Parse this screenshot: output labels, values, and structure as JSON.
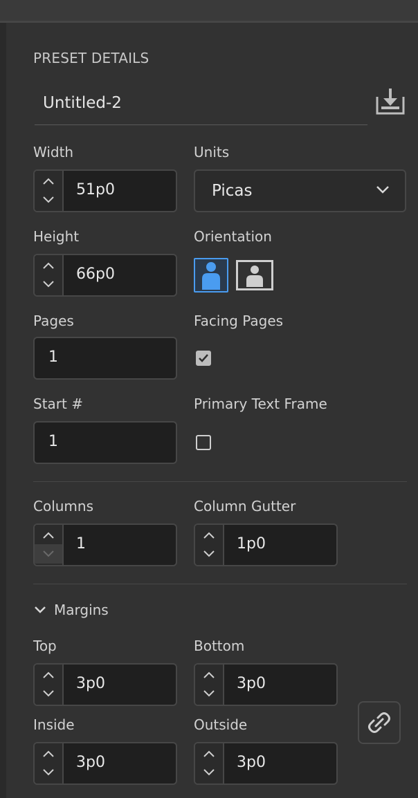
{
  "panel": {
    "section_title": "PRESET DETAILS",
    "document_name": "Untitled-2",
    "save_preset_icon": "save-preset-icon"
  },
  "fields": {
    "width": {
      "label": "Width",
      "value": "51p0"
    },
    "height": {
      "label": "Height",
      "value": "66p0"
    },
    "units": {
      "label": "Units",
      "value": "Picas"
    },
    "orientation": {
      "label": "Orientation",
      "selected": "portrait"
    },
    "pages": {
      "label": "Pages",
      "value": "1"
    },
    "facing_pages": {
      "label": "Facing Pages",
      "checked": true
    },
    "start_number": {
      "label": "Start #",
      "value": "1"
    },
    "primary_text_frame": {
      "label": "Primary Text Frame",
      "checked": false
    },
    "columns": {
      "label": "Columns",
      "value": "1"
    },
    "column_gutter": {
      "label": "Column Gutter",
      "value": "1p0"
    }
  },
  "margins": {
    "title": "Margins",
    "top": {
      "label": "Top",
      "value": "3p0"
    },
    "bottom": {
      "label": "Bottom",
      "value": "3p0"
    },
    "inside": {
      "label": "Inside",
      "value": "3p0"
    },
    "outside": {
      "label": "Outside",
      "value": "3p0"
    },
    "link_icon": "link-icon"
  },
  "colors": {
    "background": "#323232",
    "field": "#1f1f1f",
    "accent": "#4a9cf0"
  }
}
